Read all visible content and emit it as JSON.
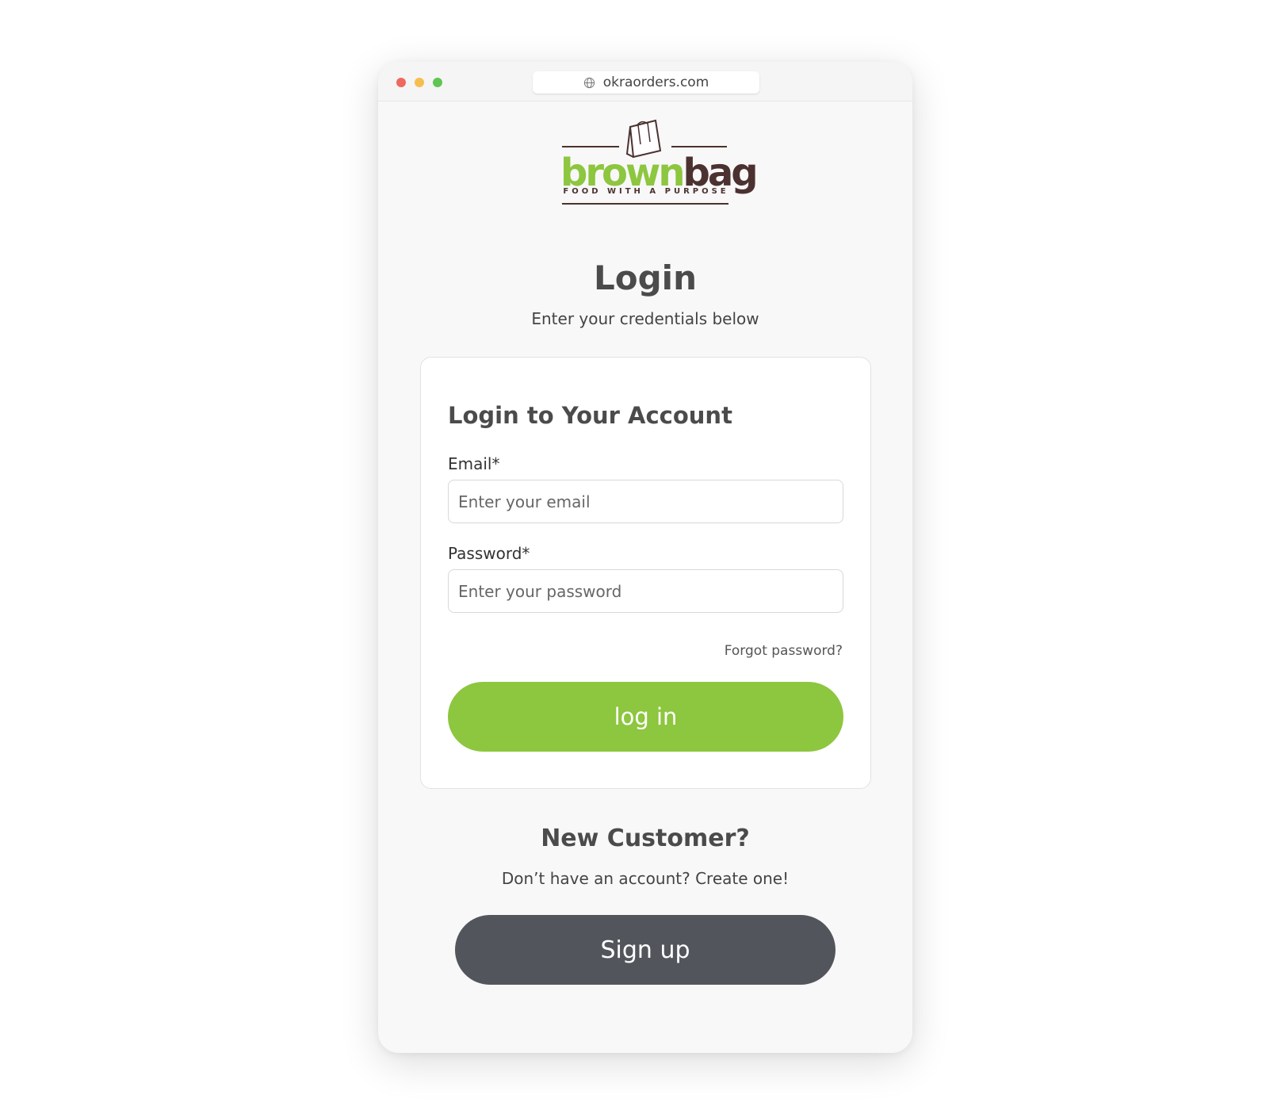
{
  "browser": {
    "url": "okraorders.com"
  },
  "logo": {
    "word_green": "brown",
    "word_brown": "bag",
    "tagline": "FOOD WITH A PURPOSE"
  },
  "header": {
    "title": "Login",
    "subtitle": "Enter your credentials below"
  },
  "login_card": {
    "title": "Login to Your Account",
    "email_label": "Email*",
    "email_placeholder": "Enter your email",
    "password_label": "Password*",
    "password_placeholder": "Enter your password",
    "forgot_label": "Forgot password?",
    "login_label": "log in"
  },
  "signup": {
    "title": "New Customer?",
    "text": "Don’t have an account? Create one!",
    "button_label": "Sign up"
  },
  "colors": {
    "accent_green": "#8dc63f",
    "brand_brown": "#4b3230",
    "signup_gray": "#52565c"
  }
}
